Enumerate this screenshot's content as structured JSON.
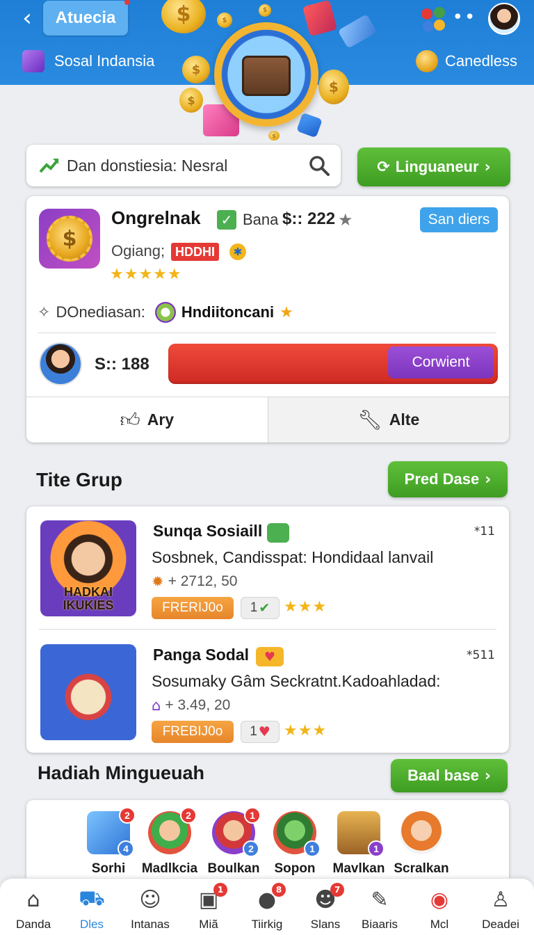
{
  "header": {
    "back_icon": "chevron-left-icon",
    "title": "Atuecia",
    "left_label": "Sosal Indansia",
    "right_label": "Canedless",
    "apps_icon": "apps-icon",
    "more_icon": "more-dots-icon",
    "avatar_icon": "avatar-icon"
  },
  "search": {
    "text": "Dan donstiesia: Nesral",
    "language_button": "Linguaneur"
  },
  "profile": {
    "name": "Ongrelnak",
    "bana_label": "Bana",
    "amount": "$:: 222",
    "badge": "San diers",
    "status_label": "Ogiang;",
    "hot_tag": "HDDHI",
    "rating_stars": 5,
    "description_label": "DOnediasan:",
    "description_value": "Hndiitoncani",
    "score": "S:: 188",
    "convert_button": "Corwient",
    "action_like": "Ary",
    "action_alt": "Alte"
  },
  "groups": {
    "title": "Tite Grup",
    "more_button": "Pred Dase",
    "items": [
      {
        "title": "Sunqa Sosiaill",
        "rank": "*11",
        "thumb_text": "HADKAI IKUKIES",
        "description": "Sosbnek, Candisspat: Hondidaal lanvail",
        "meta": "+ 2712, 50",
        "free_label": "FRERIJ0o",
        "count": "1",
        "rating_stars": 3
      },
      {
        "title": "Panga Sodal",
        "rank": "*511",
        "thumb_text": "",
        "description": "Sosumaky Gâm Seckratnt.Kadoahladad:",
        "meta": "+ 3.49, 20",
        "free_label": "FREBIJ0o",
        "count": "1",
        "rating_stars": 3
      }
    ]
  },
  "rewards": {
    "title": "Hadiah Mingueuah",
    "more_button": "Baal base",
    "items": [
      {
        "label": "Sorhi",
        "badge_top": "2",
        "badge_bottom": "4"
      },
      {
        "label": "Madlkcia",
        "badge_top": "2",
        "badge_bottom": ""
      },
      {
        "label": "Boulkan",
        "badge_top": "1",
        "badge_bottom": "2"
      },
      {
        "label": "Sopon",
        "badge_top": "",
        "badge_bottom": "1"
      },
      {
        "label": "Mavlkan",
        "badge_top": "",
        "badge_bottom": "1"
      },
      {
        "label": "Scralkan",
        "badge_top": "",
        "badge_bottom": ""
      }
    ]
  },
  "nav": {
    "items": [
      {
        "label": "Danda",
        "icon": "home-icon",
        "badge": ""
      },
      {
        "label": "Dles",
        "icon": "cart-icon",
        "badge": ""
      },
      {
        "label": "Intanas",
        "icon": "person-icon",
        "badge": ""
      },
      {
        "label": "Miã",
        "icon": "gift-icon",
        "badge": "1"
      },
      {
        "label": "Tiirkig",
        "icon": "user-avatar-icon",
        "badge": "8"
      },
      {
        "label": "Slans",
        "icon": "group-icon",
        "badge": "7"
      },
      {
        "label": "Biaaris",
        "icon": "pen-icon",
        "badge": ""
      },
      {
        "label": "Mcl",
        "icon": "location-icon",
        "badge": ""
      },
      {
        "label": "Deadei",
        "icon": "account-icon",
        "badge": ""
      }
    ],
    "active_index": 1
  },
  "colors": {
    "header_blue": "#2a8ae0",
    "green_button": "#4caf32",
    "progress_red": "#e03a2f",
    "convert_purple": "#8a3fca",
    "free_orange": "#ef9436"
  }
}
